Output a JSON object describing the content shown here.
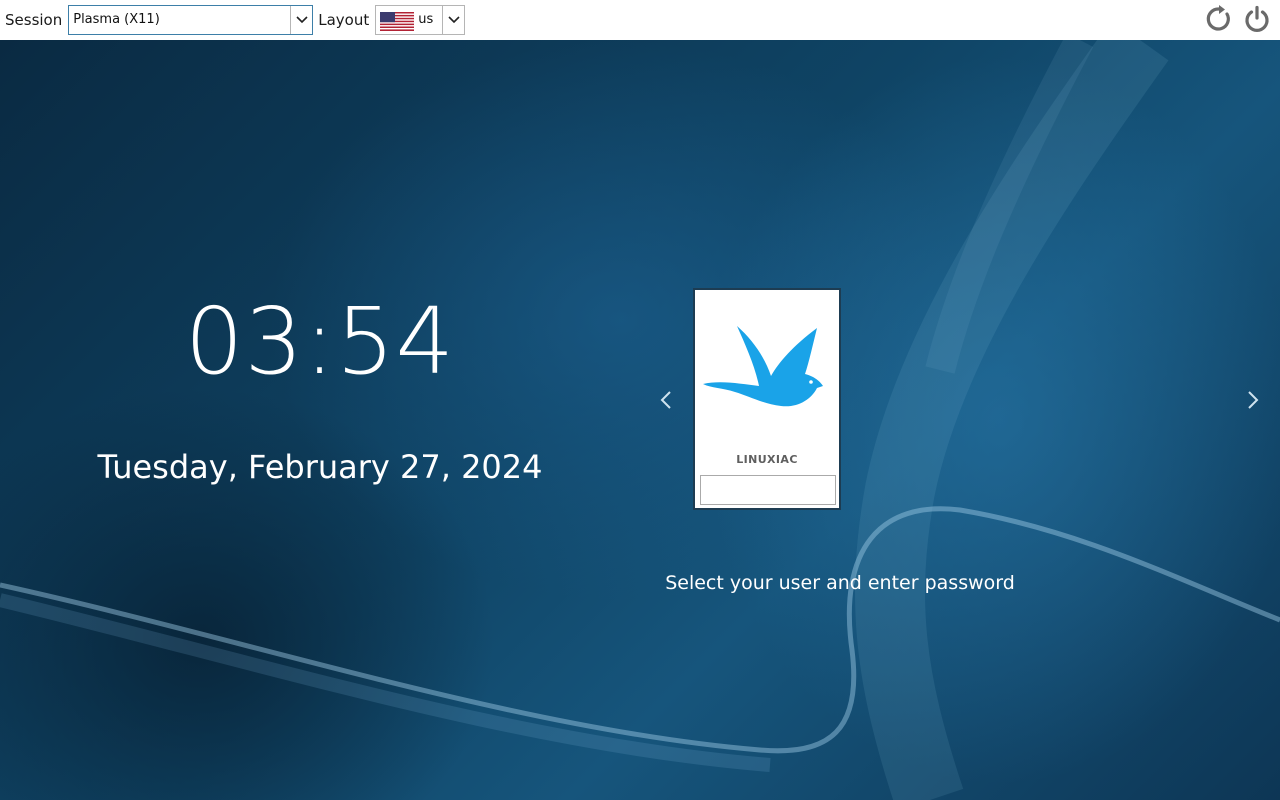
{
  "topbar": {
    "session_label": "Session",
    "session_value": "Plasma (X11)",
    "layout_label": "Layout",
    "layout_value": "us",
    "layout_flag_icon": "us-flag-icon",
    "restart_icon": "restart-icon",
    "power_icon": "power-icon"
  },
  "clock": {
    "time": "03:54",
    "date": "Tuesday, February 27, 2024"
  },
  "user": {
    "name": "LINUXIAC",
    "avatar_icon": "bird-icon",
    "password_value": ""
  },
  "hint": "Select your user and enter password",
  "colors": {
    "accent_bird": "#1aa3e8",
    "select_focus_border": "#3d7fa8",
    "topbar_bg": "#ffffff"
  }
}
